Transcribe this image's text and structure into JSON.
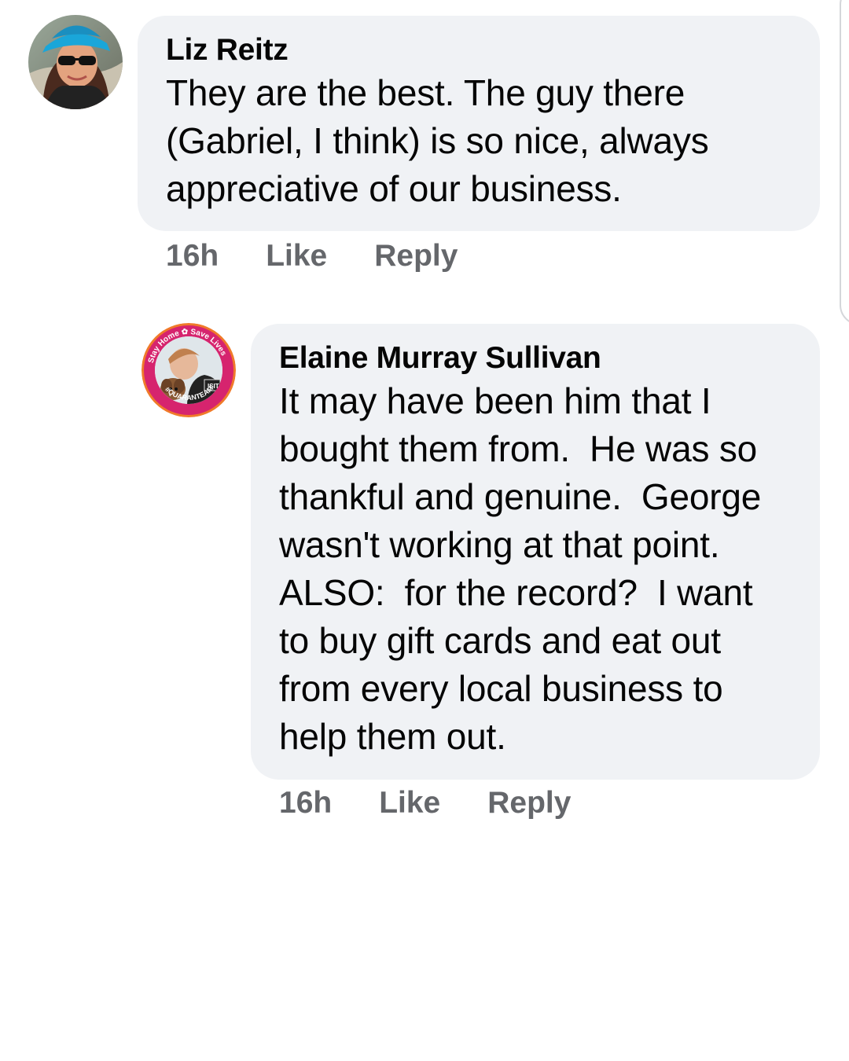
{
  "comments": [
    {
      "author": "Liz Reitz",
      "lines": [
        "They are the best. The guy there",
        "(Gabriel, I think) is so nice, always",
        "appreciative of our business."
      ],
      "time": "16h",
      "like_label": "Like",
      "reply_label": "Reply"
    },
    {
      "author": "Elaine Murray Sullivan",
      "avatar_frame": {
        "top_text": "Stay Home ✿ Save Lives",
        "bottom_text": "#QUARANTEAM",
        "shirt_text": "ISIT"
      },
      "lines": [
        "It may have been him that I",
        "bought them from.  He was so",
        "thankful and genuine.  George",
        "wasn't working at that point.",
        "ALSO:  for the record?  I want",
        "to buy gift cards and eat out",
        "from every local business to",
        "help them out."
      ],
      "time": "16h",
      "like_label": "Like",
      "reply_label": "Reply"
    }
  ],
  "colors": {
    "bubble": "#f0f2f5",
    "meta_text": "#65676b",
    "frame_ring": "#d6246e",
    "frame_ring_outer": "#f07a2a"
  }
}
